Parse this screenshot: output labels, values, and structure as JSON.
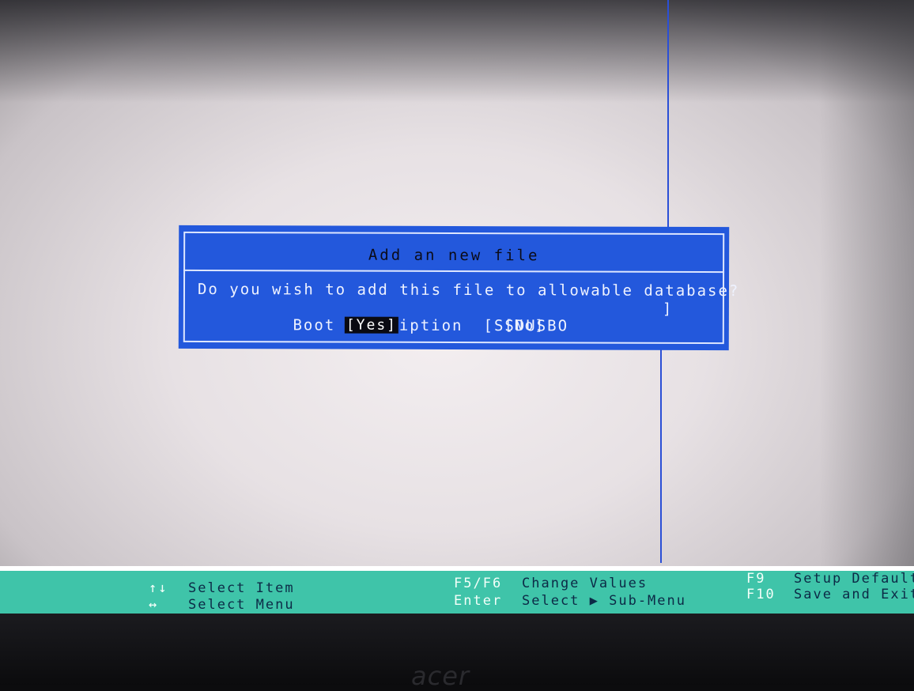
{
  "dialog": {
    "title": "Add an new file",
    "question": "Do you wish to add this file to allowable database?",
    "boot_description_label": "Boot Description",
    "boot_description_value": "[SSDUSBO",
    "boot_description_close": "]",
    "yes_label": "[Yes]",
    "no_label": "[No]"
  },
  "helpbar": {
    "updown_icon": "↑↓",
    "select_item": "Select Item",
    "leftright_icon": "↔",
    "select_menu": "Select Menu",
    "f5f6_key": "F5/F6",
    "change_values": "Change Values",
    "enter_key": "Enter",
    "select_submenu": "Select ▶ Sub-Menu",
    "f9_key": "F9",
    "setup_defaults": "Setup Defaults",
    "f10_key": "F10",
    "save_exit": "Save and Exit"
  },
  "brand": "acer",
  "colors": {
    "dialog_bg": "#2358dc",
    "helpbar_bg": "#3fc4a9",
    "screen_bg": "#e7e1e4"
  }
}
